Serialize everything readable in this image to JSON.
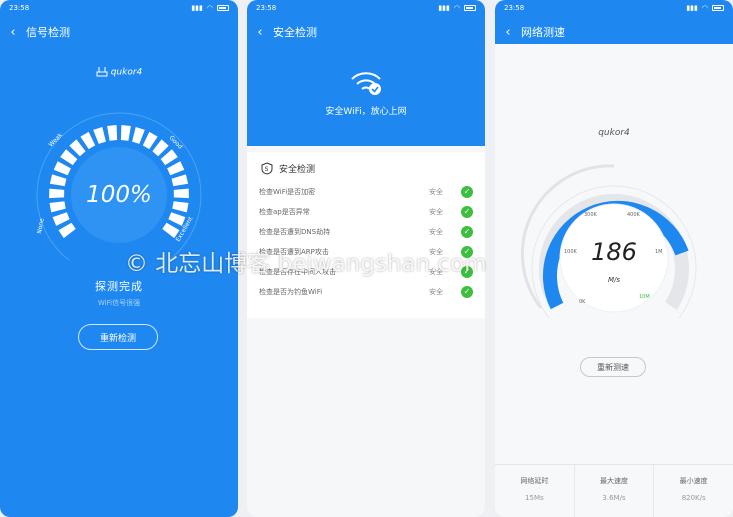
{
  "colors": {
    "primary": "#1e88f0",
    "check": "#3cbf3c"
  },
  "status_bar": {
    "time1": "23:58",
    "time2": "23:58",
    "time3": "23:58"
  },
  "screen1": {
    "title": "信号检测",
    "router_name": "qukor4",
    "gauge_labels": {
      "weak": "Weak",
      "good": "Good",
      "none": "None",
      "excellent": "Excellent"
    },
    "percent": "100%",
    "percent_value": 1.0,
    "status": "探测完成",
    "subtext": "WiFi信号很强",
    "button": "重新检测"
  },
  "screen2": {
    "title": "安全检测",
    "hero_text": "安全WiFi，放心上网",
    "card_title": "安全检测",
    "items": [
      {
        "label": "检查WiFi是否加密",
        "status": "安全"
      },
      {
        "label": "检查ap是否异常",
        "status": "安全"
      },
      {
        "label": "检查是否遭到DNS劫持",
        "status": "安全"
      },
      {
        "label": "检查是否遭到ARP攻击",
        "status": "安全"
      },
      {
        "label": "检查是否存在中间人攻击",
        "status": "安全"
      },
      {
        "label": "检查是否为钓鱼WiFi",
        "status": "安全"
      }
    ]
  },
  "screen3": {
    "title": "网络测速",
    "router_name": "qukor4",
    "speed": "186",
    "unit": "M/s",
    "scale_labels": [
      "0K",
      "100K",
      "300K",
      "400K",
      "1M",
      "10M"
    ],
    "button": "重新测速",
    "stats": [
      {
        "label": "网络延时",
        "value": "15Ms"
      },
      {
        "label": "最大速度",
        "value": "3.6M/s"
      },
      {
        "label": "最小速度",
        "value": "820K/s"
      }
    ]
  },
  "watermark": "© 北忘山博客 beiwangshan.com"
}
